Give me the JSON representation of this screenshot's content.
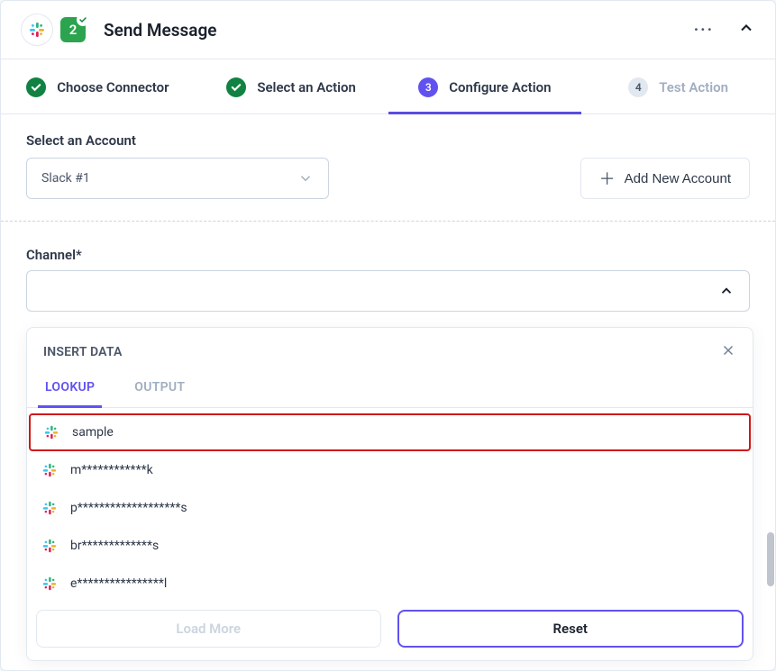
{
  "header": {
    "step_number": "2",
    "title": "Send Message"
  },
  "steps": [
    {
      "label": "Choose Connector",
      "state": "done"
    },
    {
      "label": "Select an Action",
      "state": "done"
    },
    {
      "label": "Configure Action",
      "state": "current",
      "number": "3"
    },
    {
      "label": "Test Action",
      "state": "future",
      "number": "4"
    }
  ],
  "account": {
    "section_label": "Select an Account",
    "selected": "Slack #1",
    "add_button": "Add New Account"
  },
  "channel": {
    "label": "Channel*"
  },
  "insert": {
    "title": "INSERT DATA",
    "tabs": {
      "lookup": "LOOKUP",
      "output": "OUTPUT"
    },
    "items": [
      {
        "label": "sample",
        "highlight": true
      },
      {
        "label": "m************k"
      },
      {
        "label": "p*******************s"
      },
      {
        "label": "br*************s"
      },
      {
        "label": "e****************l"
      }
    ],
    "load_more": "Load More",
    "reset": "Reset"
  }
}
